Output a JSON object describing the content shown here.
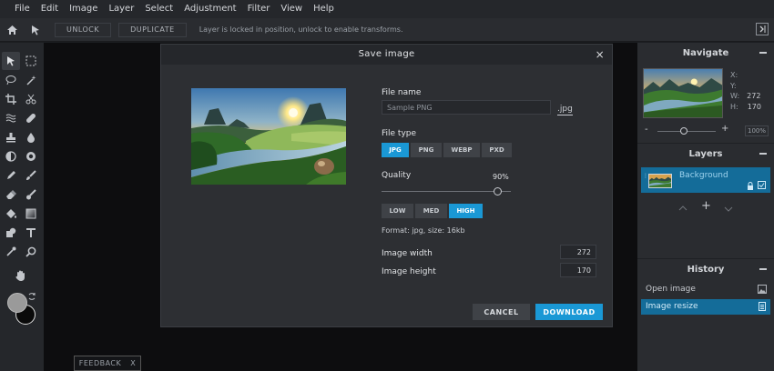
{
  "menu": [
    "File",
    "Edit",
    "Image",
    "Layer",
    "Select",
    "Adjustment",
    "Filter",
    "View",
    "Help"
  ],
  "toolbar": {
    "unlock": "UNLOCK",
    "duplicate": "DUPLICATE",
    "message": "Layer is locked in position, unlock to enable transforms."
  },
  "feedback": {
    "label": "FEEDBACK",
    "close": "X"
  },
  "navigate": {
    "title": "Navigate",
    "x_label": "X:",
    "y_label": "Y:",
    "w_label": "W:",
    "w_value": "272",
    "h_label": "H:",
    "h_value": "170",
    "zoom": "100%",
    "minus": "-",
    "plus": "+"
  },
  "layers": {
    "title": "Layers",
    "item": "Background",
    "add": "+"
  },
  "history": {
    "title": "History",
    "items": [
      "Open image",
      "Image resize"
    ]
  },
  "dialog": {
    "title": "Save image",
    "close": "×",
    "file_name_label": "File name",
    "file_name_placeholder": "Sample PNG",
    "extension": ".jpg",
    "file_type_label": "File type",
    "file_types": [
      "JPG",
      "PNG",
      "WEBP",
      "PXD"
    ],
    "quality_label": "Quality",
    "quality_value": "90%",
    "quality_fraction": 0.9,
    "presets": [
      "LOW",
      "MED",
      "HIGH"
    ],
    "format_info": "Format: jpg, size: 16kb",
    "width_label": "Image width",
    "width_value": "272",
    "height_label": "Image height",
    "height_value": "170",
    "cancel": "CANCEL",
    "download": "DOWNLOAD"
  },
  "colors": {
    "accent": "#1a98d5",
    "selected_row": "#146c99"
  }
}
